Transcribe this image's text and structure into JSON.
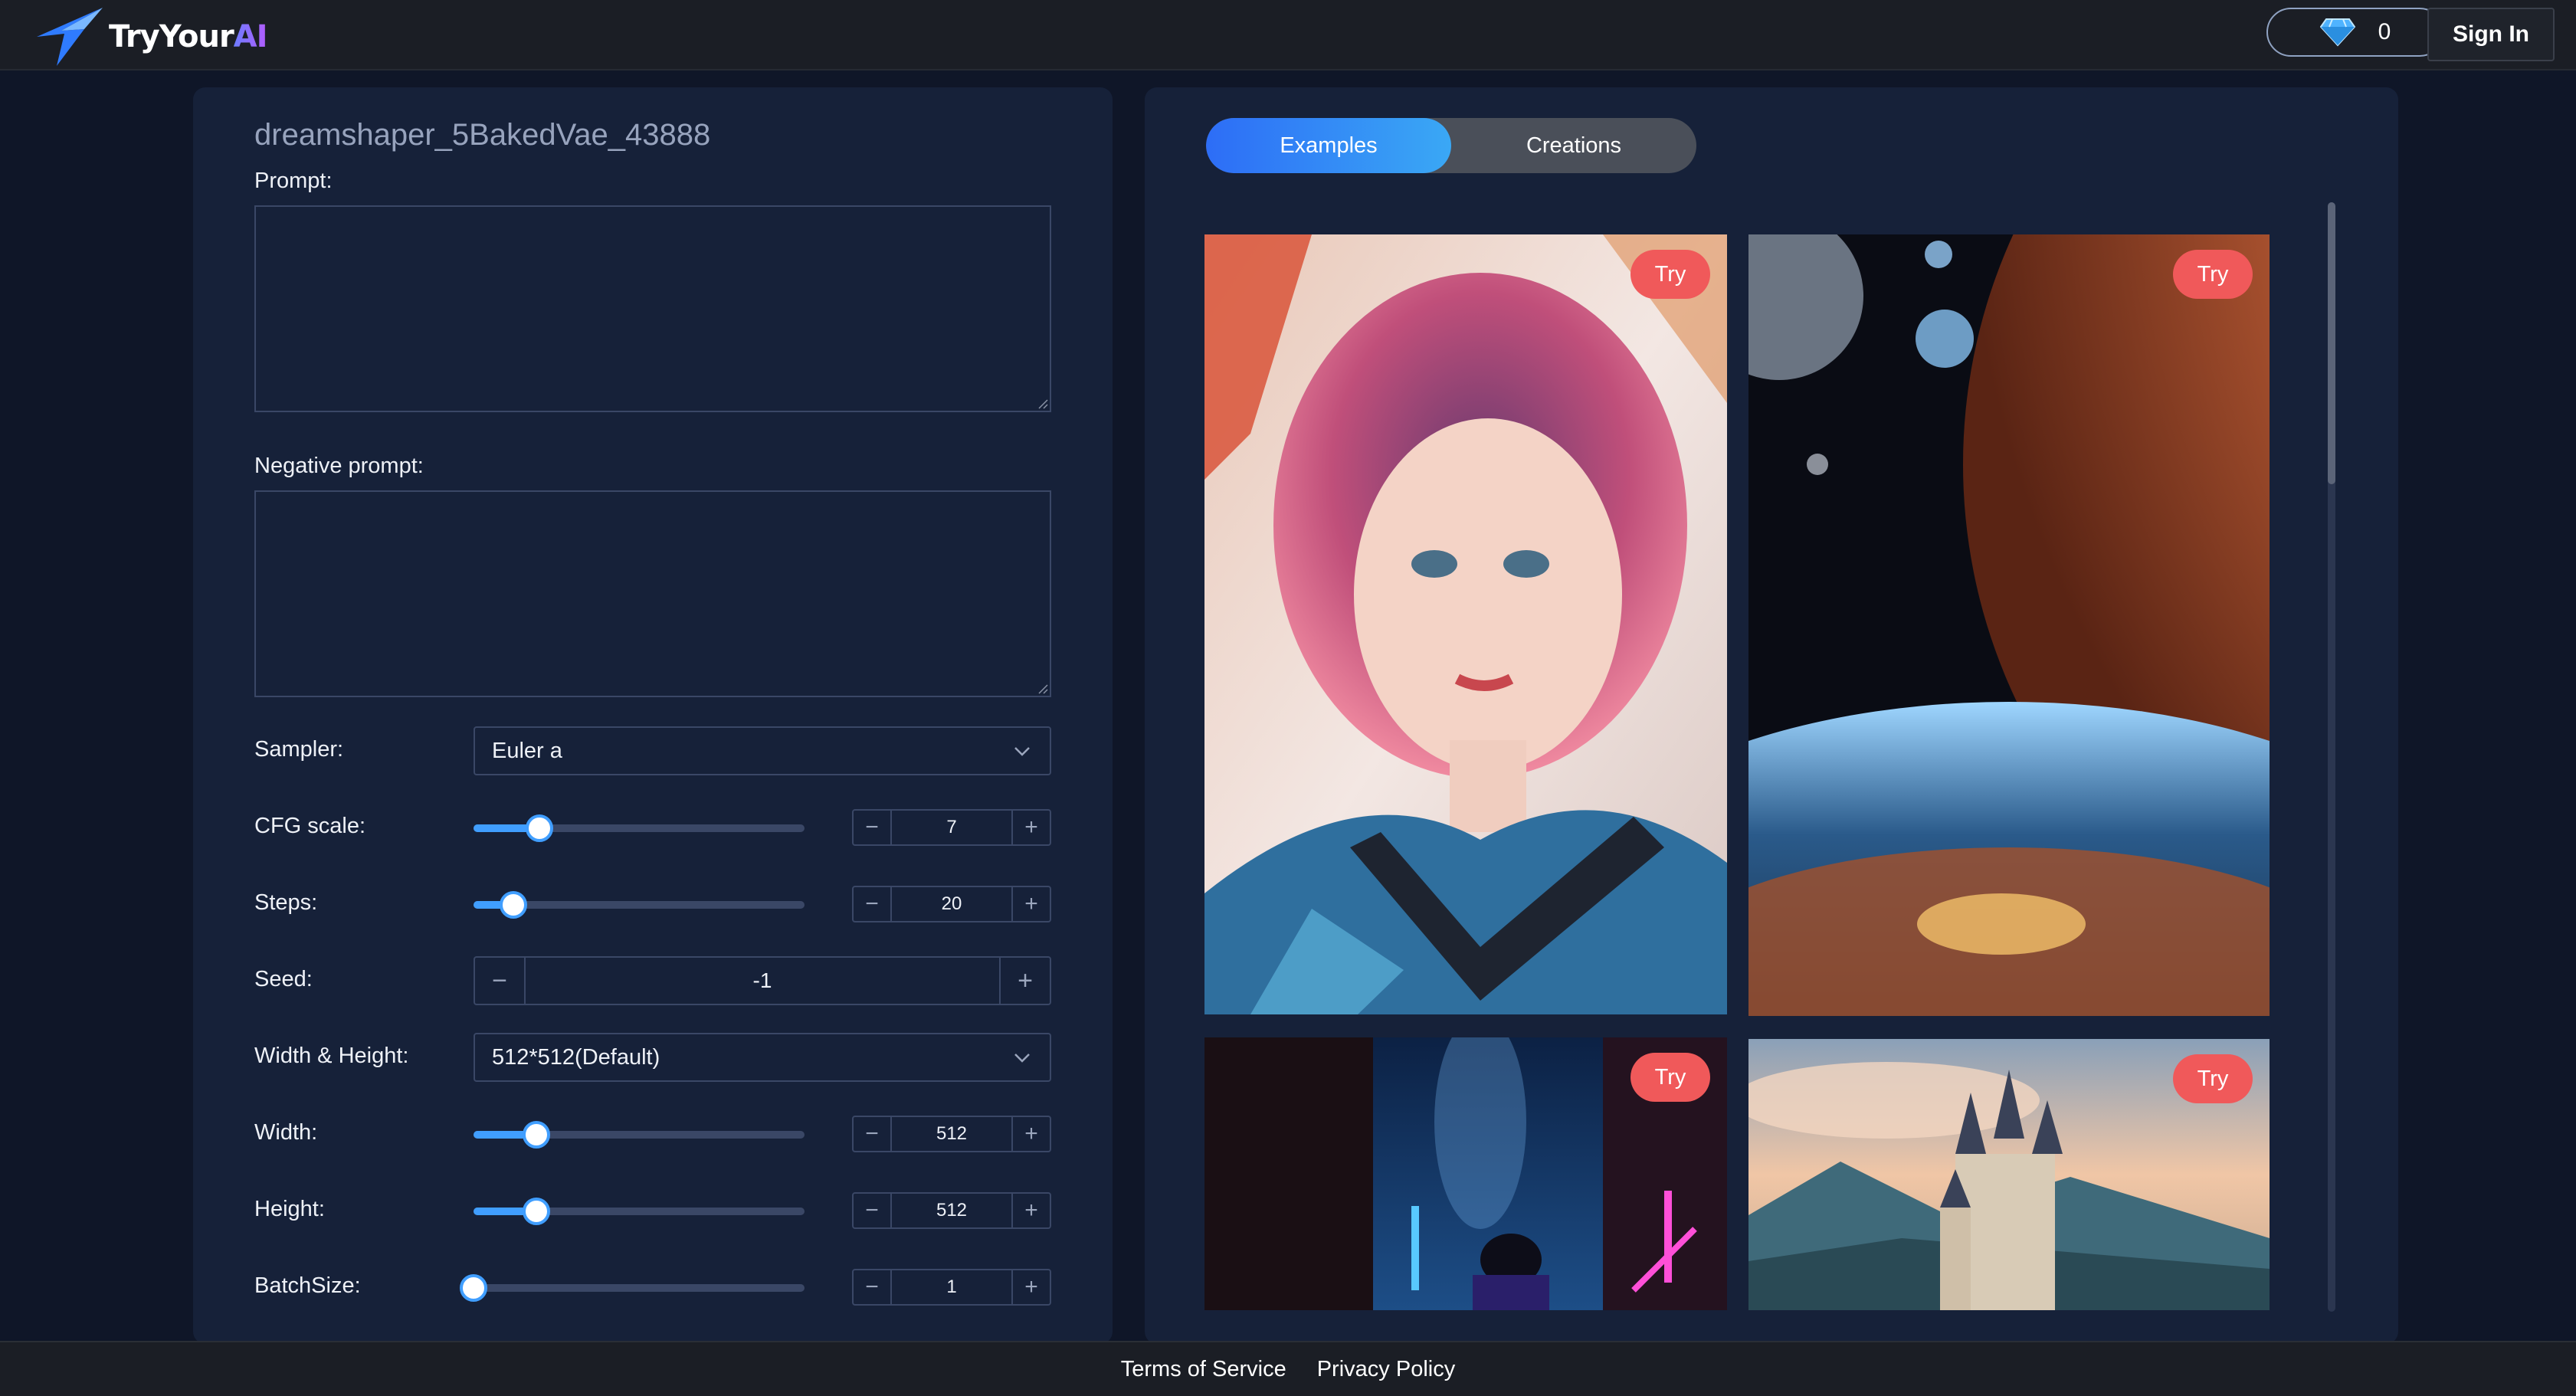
{
  "header": {
    "logo_text_main": "TryYour",
    "logo_text_accent": "AI",
    "credits_count": "0",
    "sign_in_label": "Sign In"
  },
  "form": {
    "model_name": "dreamshaper_5BakedVae_43888",
    "prompt_label": "Prompt:",
    "prompt_value": "",
    "negative_prompt_label": "Negative prompt:",
    "negative_prompt_value": "",
    "sampler": {
      "label": "Sampler:",
      "value": "Euler a"
    },
    "cfg_scale": {
      "label": "CFG scale:",
      "value": "7",
      "fraction": 0.2
    },
    "steps": {
      "label": "Steps:",
      "value": "20",
      "fraction": 0.12
    },
    "seed": {
      "label": "Seed:",
      "value": "-1"
    },
    "width_height": {
      "label": "Width & Height:",
      "value": "512*512(Default)"
    },
    "width": {
      "label": "Width:",
      "value": "512",
      "fraction": 0.19
    },
    "height": {
      "label": "Height:",
      "value": "512",
      "fraction": 0.19
    },
    "batch_size": {
      "label": "BatchSize:",
      "value": "1",
      "fraction": 0.0
    }
  },
  "gallery": {
    "tabs": [
      {
        "label": "Examples",
        "active": true
      },
      {
        "label": "Creations",
        "active": false
      }
    ],
    "try_label": "Try",
    "scroll_fraction": 0.0
  },
  "footer": {
    "terms": "Terms of Service",
    "privacy": "Privacy Policy"
  },
  "colors": {
    "accent": "#409eff",
    "try_badge": "#f0595a",
    "panel": "#162139",
    "background": "#0f1628"
  }
}
